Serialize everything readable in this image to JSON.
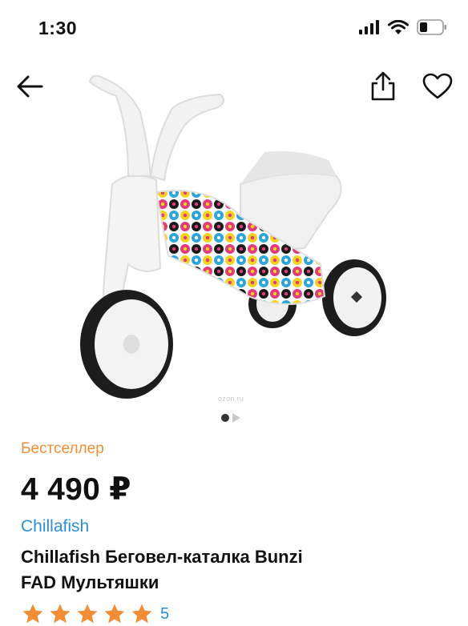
{
  "status": {
    "time": "1:30"
  },
  "product": {
    "badge": "Бестселлер",
    "price": "4 490 ₽",
    "brand": "Chillafish",
    "title_line1": "Chillafish Беговел-каталка Bunzi",
    "title_line2": "FAD Мультяшки",
    "watermark": "ozon.ru",
    "rating_count": "5"
  },
  "gallery": {
    "slide_count": 2,
    "active_slide": 1
  },
  "rating": {
    "stars": 5,
    "max": 5
  },
  "colors": {
    "accent_orange": "#f28d35",
    "link_blue": "#2b8fd6",
    "star_orange": "#f28d35",
    "text": "#111111"
  },
  "icons": [
    "signal-icon",
    "wifi-icon",
    "battery-icon",
    "back-arrow-icon",
    "share-icon",
    "heart-icon",
    "star-icon"
  ]
}
